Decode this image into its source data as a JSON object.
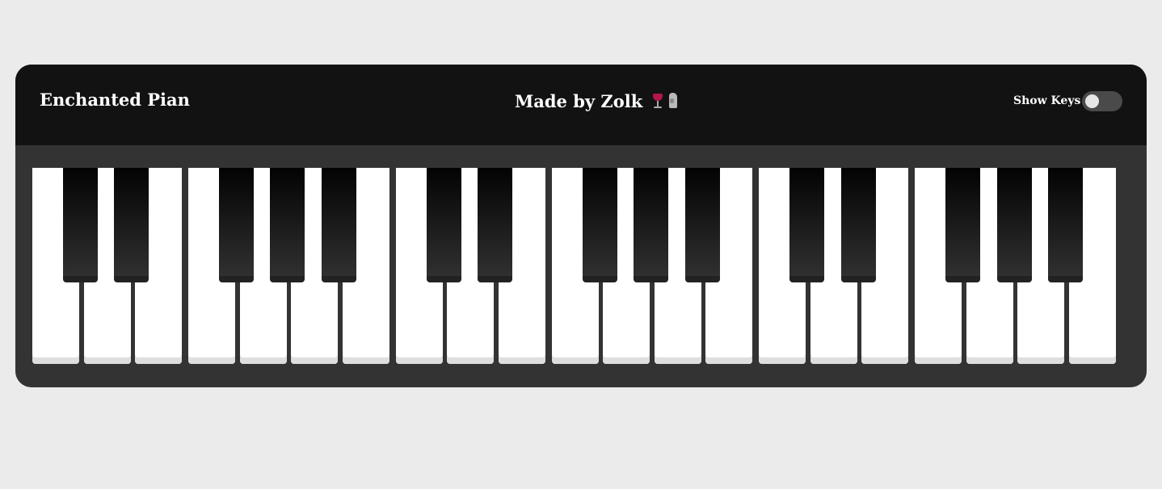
{
  "header": {
    "title": "Enchanted Pian",
    "credit": "Made by Zolk",
    "credit_emojis": [
      "wine-glass-icon",
      "moai-icon"
    ],
    "toggle_label": "Show Keys",
    "toggle_on": false
  },
  "keyboard": {
    "white_key_count": 21,
    "octaves": 3,
    "colors": {
      "white": "#ffffff",
      "black": "#111111",
      "frame": "#333333",
      "header": "#121212",
      "page": "#ebebeb"
    }
  }
}
